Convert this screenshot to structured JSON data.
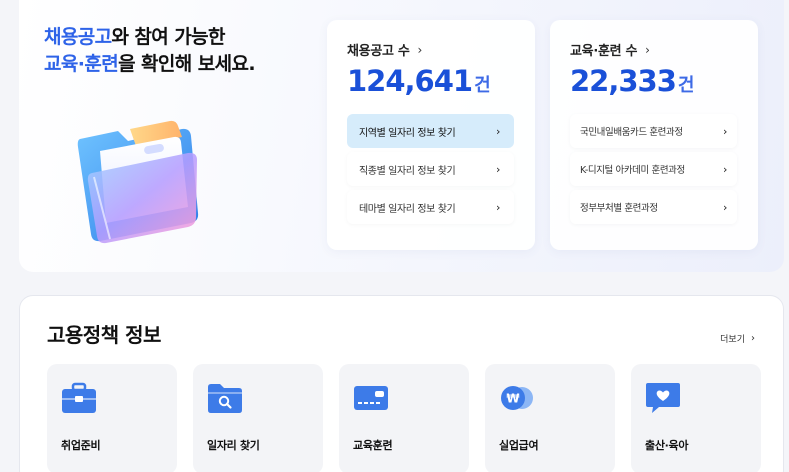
{
  "hero": {
    "headline": {
      "line1_highlight": "채용공고",
      "line1_rest": "와 참여 가능한",
      "line2_highlight": "교육·훈련",
      "line2_rest": "을 확인해 보세요."
    },
    "illustration_icon": "folder-icon"
  },
  "jobs_card": {
    "title": "채용공고 수",
    "count": "124,641",
    "unit": "건",
    "links": [
      {
        "label": "지역별 일자리 정보 찾기",
        "active": true
      },
      {
        "label": "직종별 일자리 정보 찾기",
        "active": false
      },
      {
        "label": "테마별 일자리 정보 찾기",
        "active": false
      }
    ]
  },
  "edu_card": {
    "title": "교육·훈련 수",
    "count": "22,333",
    "unit": "건",
    "links": [
      {
        "label": "국민내일배움카드 훈련과정"
      },
      {
        "label": "K-디지털 아카데미 훈련과정"
      },
      {
        "label": "정부부처별 훈련과정"
      }
    ]
  },
  "policy": {
    "title": "고용정책 정보",
    "more_label": "더보기",
    "tiles": [
      {
        "label": "취업준비",
        "icon": "briefcase-icon"
      },
      {
        "label": "일자리 찾기",
        "icon": "folder-search-icon"
      },
      {
        "label": "교육훈련",
        "icon": "card-icon"
      },
      {
        "label": "실업급여",
        "icon": "won-coin-icon"
      },
      {
        "label": "출산·육아",
        "icon": "heart-chat-icon"
      }
    ]
  },
  "colors": {
    "accent": "#1a50d8",
    "highlight": "#2e63e8",
    "active_link_bg": "#d6ecfb",
    "icon_blue": "#3d7be8"
  }
}
